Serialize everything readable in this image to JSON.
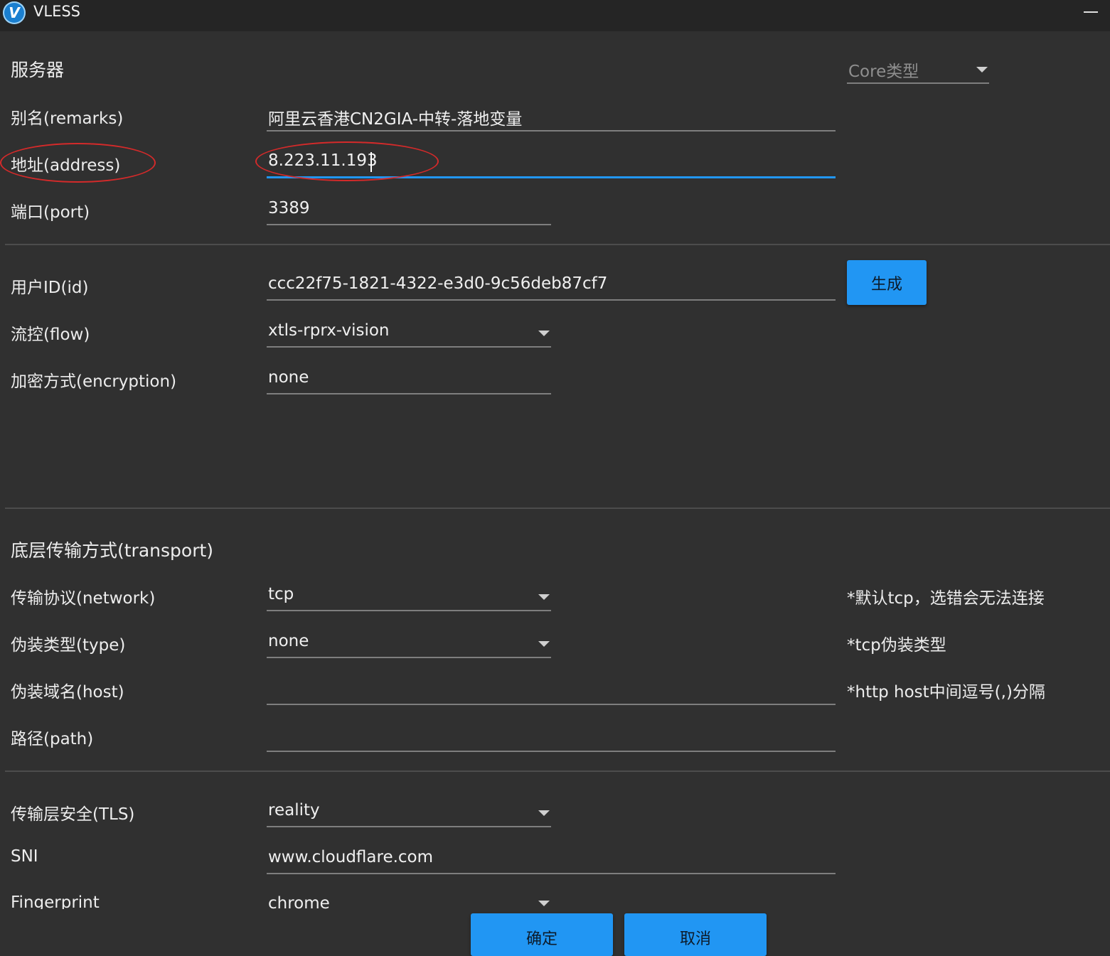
{
  "window": {
    "title": "VLESS",
    "logo_glyph": "V",
    "logo_icon": "v2rayn-logo-icon"
  },
  "server_section": {
    "title": "服务器",
    "core_type": {
      "placeholder": "Core类型"
    }
  },
  "fields": {
    "remarks": {
      "label": "别名(remarks)",
      "value": "阿里云香港CN2GIA-中转-落地变量"
    },
    "address": {
      "label": "地址(address)",
      "value": "8.223.11.193"
    },
    "port": {
      "label": "端口(port)",
      "value": "3389"
    },
    "id": {
      "label": "用户ID(id)",
      "value": "ccc22f75-1821-4322-e3d0-9c56deb87cf7",
      "generate_label": "生成"
    },
    "flow": {
      "label": "流控(flow)",
      "value": "xtls-rprx-vision"
    },
    "encryption": {
      "label": "加密方式(encryption)",
      "value": "none"
    }
  },
  "transport": {
    "title": "底层传输方式(transport)",
    "network": {
      "label": "传输协议(network)",
      "value": "tcp",
      "hint": "*默认tcp，选错会无法连接"
    },
    "type": {
      "label": "伪装类型(type)",
      "value": "none",
      "hint": "*tcp伪装类型"
    },
    "host": {
      "label": "伪装域名(host)",
      "value": "",
      "hint": "*http host中间逗号(,)分隔"
    },
    "path": {
      "label": "路径(path)",
      "value": ""
    }
  },
  "tls": {
    "security": {
      "label": "传输层安全(TLS)",
      "value": "reality"
    },
    "sni": {
      "label": "SNI",
      "value": "www.cloudflare.com"
    },
    "fingerprint": {
      "label": "Fingerprint",
      "value": "chrome"
    }
  },
  "footer": {
    "ok_label": "确定",
    "cancel_label": "取消"
  },
  "colors": {
    "accent": "#2196f3",
    "background": "#303030",
    "titlebar": "#252525",
    "annotation": "#d42a2a"
  }
}
